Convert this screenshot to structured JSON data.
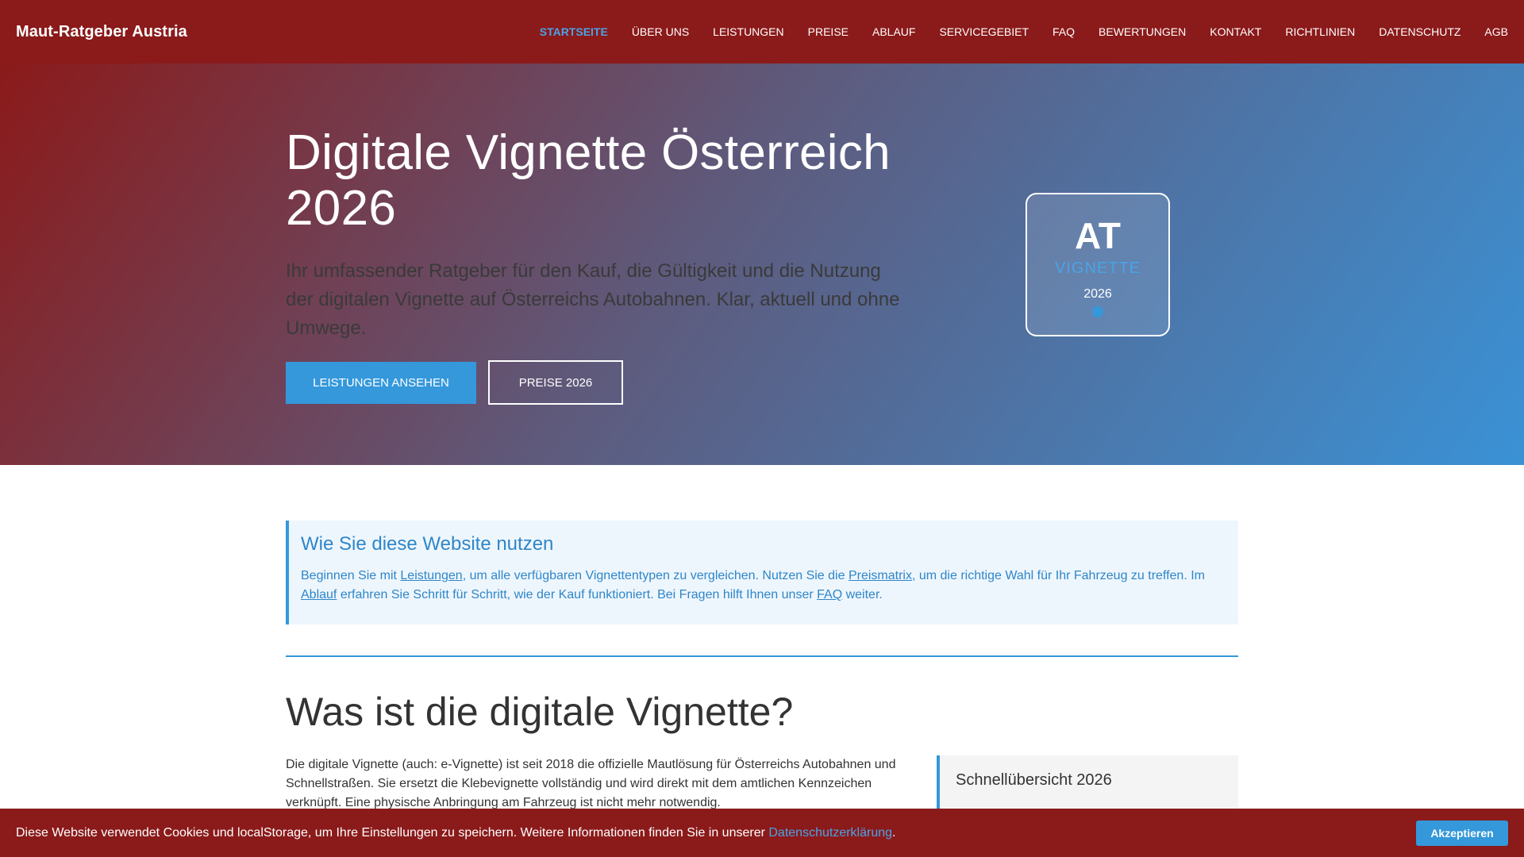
{
  "brand": "Maut-Ratgeber Austria",
  "nav": [
    {
      "label": "Startseite",
      "active": true
    },
    {
      "label": "Über uns"
    },
    {
      "label": "Leistungen"
    },
    {
      "label": "Preise"
    },
    {
      "label": "Ablauf"
    },
    {
      "label": "Servicegebiet"
    },
    {
      "label": "FAQ"
    },
    {
      "label": "Bewertungen"
    },
    {
      "label": "Kontakt"
    },
    {
      "label": "Richtlinien"
    },
    {
      "label": "Datenschutz"
    },
    {
      "label": "AGB"
    }
  ],
  "hero": {
    "title_line1": "Digitale Vignette Österreich",
    "title_line2": "2026",
    "subtitle": "Ihr umfassender Ratgeber für den Kauf, die Gültigkeit und die Nutzung der digitalen Vignette auf Österreichs Autobahnen. Klar, aktuell und ohne Umwege.",
    "primary_button": "Leistungen ansehen",
    "secondary_button": "Preise 2026",
    "badge": {
      "code": "AT",
      "word": "VIGNETTE",
      "year": "2026"
    }
  },
  "info": {
    "title": "Wie Sie diese Website nutzen",
    "t1": "Beginnen Sie mit ",
    "link1": "Leistungen",
    "t2": ", um alle verfügbaren Vignettentypen zu vergleichen. Nutzen Sie die ",
    "link2": "Preismatrix",
    "t3": ", um die richtige Wahl für Ihr Fahrzeug zu treffen. Im ",
    "link3": "Ablauf",
    "t4": " erfahren Sie Schritt für Schritt, wie der Kauf funktioniert. Bei Fragen hilft Ihnen unser ",
    "link4": "FAQ",
    "t5": " weiter."
  },
  "section": {
    "title": "Was ist die digitale Vignette?",
    "body": "Die digitale Vignette (auch: e-Vignette) ist seit 2018 die offizielle Mautlösung für Österreichs Autobahnen und Schnellstraßen. Sie ersetzt die Klebevignette vollständig und wird direkt mit dem amtlichen Kennzeichen verknüpft. Eine physische Anbringung am Fahrzeug ist nicht mehr notwendig."
  },
  "quick": {
    "title": "Schnellübersicht 2026"
  },
  "cookie": {
    "text": "Diese Website verwendet Cookies und localStorage, um Ihre Einstellungen zu speichern. Weitere Informationen finden Sie in unserer ",
    "link": "Datenschutzerklärung",
    "end": ".",
    "button": "Akzeptieren"
  },
  "colors": {
    "brand_red": "#8b1a1a",
    "accent_blue": "#3498db",
    "link_blue": "#4aa3e6"
  }
}
